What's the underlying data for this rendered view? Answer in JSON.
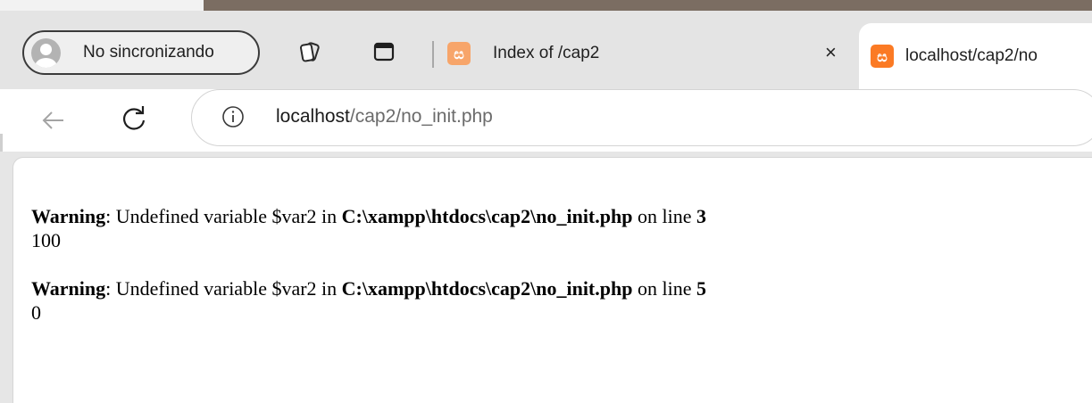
{
  "profile": {
    "label": "No sincronizando"
  },
  "tabs": [
    {
      "title": "Index of /cap2",
      "close": "×"
    },
    {
      "title": "localhost/cap2/no"
    }
  ],
  "address_bar": {
    "host": "localhost",
    "path": "/cap2/no_init.php"
  },
  "page": {
    "warnings": [
      {
        "label": "Warning",
        "message_pre": ": Undefined variable $var2 in ",
        "file": "C:\\xampp\\htdocs\\cap2\\no_init.php",
        "line_text": " on line ",
        "line": "3",
        "output": "100"
      },
      {
        "label": "Warning",
        "message_pre": ": Undefined variable $var2 in ",
        "file": "C:\\xampp\\htdocs\\cap2\\no_init.php",
        "line_text": " on line ",
        "line": "5",
        "output": "0"
      }
    ]
  },
  "colors": {
    "favicon": "#fb7a24",
    "tabstrip": "#e4e4e4",
    "window_accent": "#7b6d62"
  },
  "icons": {
    "back": "arrow-left-icon",
    "reload": "reload-icon",
    "info": "info-icon",
    "workspaces": "workspaces-icon",
    "vertical_tabs": "tab-actions-icon",
    "favicon": "xampp-favicon-icon"
  }
}
